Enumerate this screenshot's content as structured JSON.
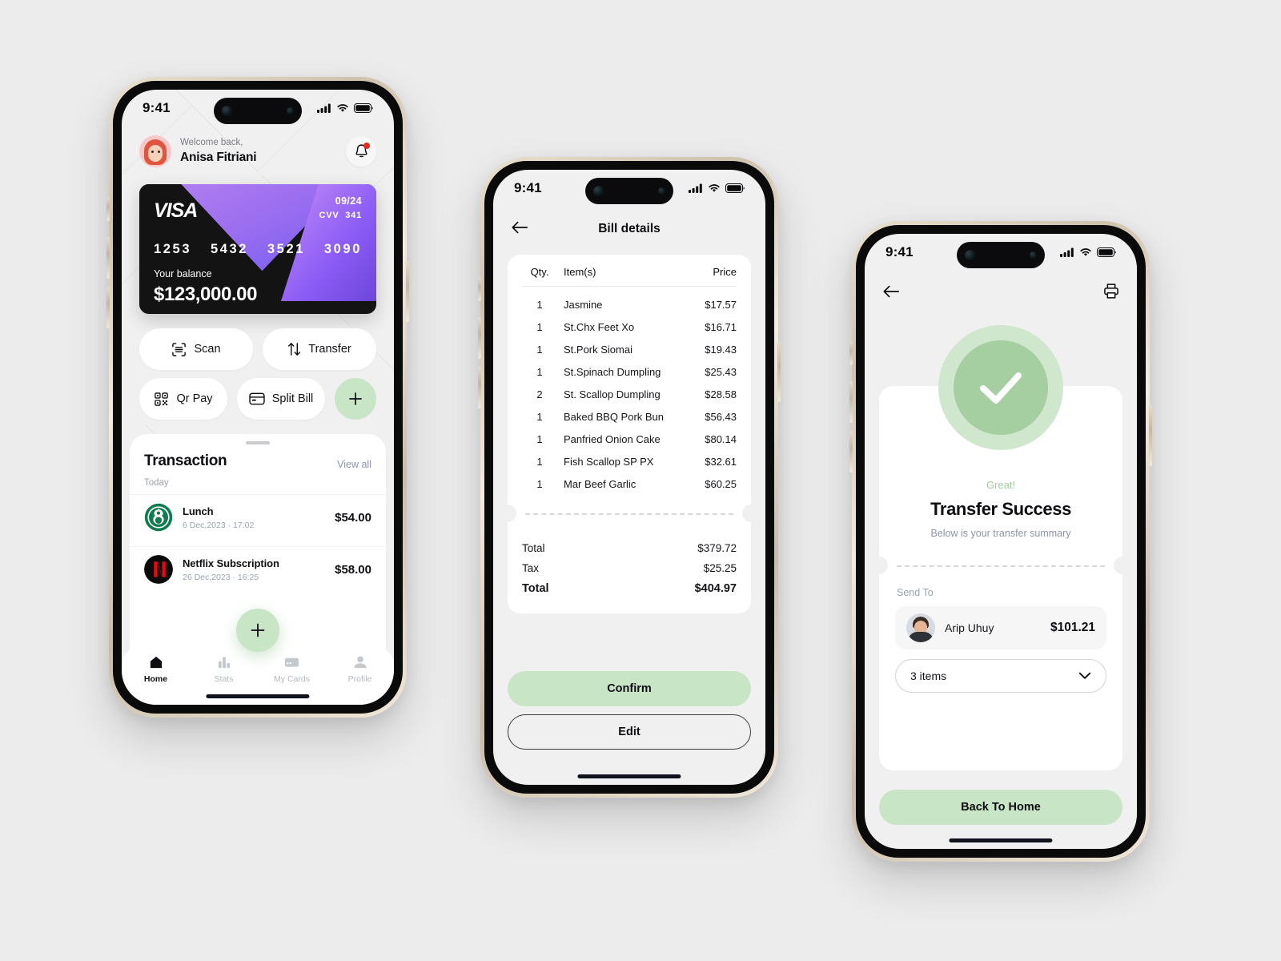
{
  "statusbar": {
    "time": "9:41"
  },
  "phone1": {
    "header": {
      "welcome": "Welcome back,",
      "name": "Anisa Fitriani",
      "bell_icon": "bell-icon"
    },
    "card": {
      "brand": "VISA",
      "expiry": "09/24",
      "cvv_label": "CVV",
      "cvv": "341",
      "number_groups": [
        "1253",
        "5432",
        "3521",
        "3090"
      ],
      "balance_label": "Your balance",
      "balance": "$123,000.00",
      "base_color": "#131313",
      "accent_color": "#8b5cf6"
    },
    "actions": [
      {
        "label": "Scan",
        "icon": "scan-icon"
      },
      {
        "label": "Transfer",
        "icon": "transfer-arrows-icon"
      },
      {
        "label": "Qr Pay",
        "icon": "qr-code-icon"
      },
      {
        "label": "Split Bill",
        "icon": "card-icon"
      }
    ],
    "add_button": {
      "icon": "plus-icon"
    },
    "transactions": {
      "title": "Transaction",
      "view_all": "View all",
      "group_label": "Today",
      "items": [
        {
          "name": "Lunch",
          "date": "6 Dec,2023 · 17:02",
          "amount": "$54.00",
          "icon": "starbucks-logo"
        },
        {
          "name": "Netflix Subscription",
          "date": "26 Dec,2023 · 16:25",
          "amount": "$58.00",
          "icon": "netflix-logo"
        }
      ]
    },
    "fab": {
      "icon": "plus-icon"
    },
    "tabs": [
      {
        "label": "Home",
        "icon": "home-icon",
        "active": true
      },
      {
        "label": "Stats",
        "icon": "bar-chart-icon",
        "active": false
      },
      {
        "label": "My Cards",
        "icon": "credit-card-icon",
        "active": false
      },
      {
        "label": "Profile",
        "icon": "person-icon",
        "active": false
      }
    ]
  },
  "phone2": {
    "nav": {
      "back_icon": "back-arrow-icon",
      "title": "Bill details"
    },
    "table": {
      "headers": {
        "qty": "Qty.",
        "item": "Item(s)",
        "price": "Price"
      },
      "rows": [
        {
          "qty": "1",
          "item": "Jasmine",
          "price": "$17.57"
        },
        {
          "qty": "1",
          "item": "St.Chx Feet Xo",
          "price": "$16.71"
        },
        {
          "qty": "1",
          "item": "St.Pork Siomai",
          "price": "$19.43"
        },
        {
          "qty": "1",
          "item": "St.Spinach Dumpling",
          "price": "$25.43"
        },
        {
          "qty": "2",
          "item": "St. Scallop Dumpling",
          "price": "$28.58"
        },
        {
          "qty": "1",
          "item": "Baked BBQ Pork Bun",
          "price": "$56.43"
        },
        {
          "qty": "1",
          "item": "Panfried Onion Cake",
          "price": "$80.14"
        },
        {
          "qty": "1",
          "item": "Fish Scallop SP PX",
          "price": "$32.61"
        },
        {
          "qty": "1",
          "item": "Mar Beef Garlic",
          "price": "$60.25"
        }
      ]
    },
    "totals": [
      {
        "label": "Total",
        "value": "$379.72"
      },
      {
        "label": "Tax",
        "value": "$25.25"
      },
      {
        "label": "Total",
        "value": "$404.97"
      }
    ],
    "confirm_label": "Confirm",
    "edit_label": "Edit"
  },
  "phone3": {
    "nav": {
      "back_icon": "back-arrow-icon",
      "print_icon": "printer-icon"
    },
    "success": {
      "check_icon": "check-icon",
      "eyebrow": "Great!",
      "title": "Transfer Success",
      "subtitle": "Below is your transfer summary"
    },
    "send_to_label": "Send To",
    "recipient": {
      "name": "Arip Uhuy",
      "amount": "$101.21",
      "avatar": "avatar"
    },
    "items_select": {
      "value": "3 items",
      "chevron_icon": "chevron-down-icon"
    },
    "back_home_label": "Back To Home"
  },
  "colors": {
    "mint": "#c8e6c5",
    "mint_dark": "#a5cea1",
    "bg": "#ececec",
    "purple": "#8b5cf6"
  }
}
